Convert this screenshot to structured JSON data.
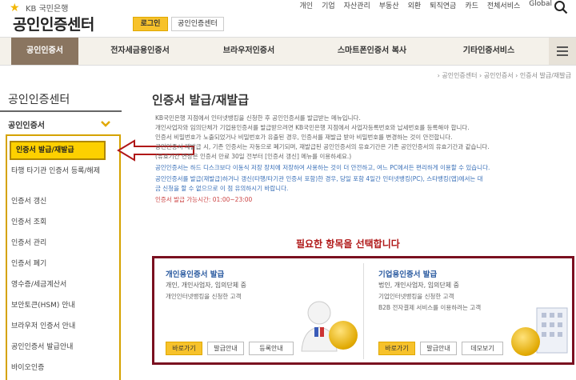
{
  "header": {
    "bank_logo_text": "KB 국민은행",
    "site_title": "공인인증센터",
    "login_label": "로그인",
    "cert_center_label": "공인인증센터",
    "gnb": [
      "개인",
      "기업",
      "자산관리",
      "부동산",
      "외환",
      "퇴직연금",
      "카드",
      "전체서비스",
      "Global"
    ]
  },
  "nav": {
    "items": [
      "공인인증서",
      "전자세금용인증서",
      "브라우저인증서",
      "스마트폰인증서 복사",
      "기타인증서비스"
    ]
  },
  "breadcrumb": "› 공인인증센터 › 공인인증서 › 인증서 발급/재발급",
  "sidebar": {
    "title": "공인인증센터",
    "group": "공인인증서",
    "items": [
      "인증서 발급/재발급",
      "타행 타기관 인증서 등록/해제",
      "인증서 갱신",
      "인증서 조회",
      "인증서 관리",
      "인증서 폐기",
      "영수증/세금계산서",
      "보안토큰(HSM) 안내",
      "브라우저 인증서 안내",
      "공인인증서 발급안내",
      "바이오인증"
    ]
  },
  "content": {
    "title": "인증서 발급/재발급",
    "bullets": [
      "KB국민은행 지점에서 인터넷뱅킹을 신청한 후 공인인증서를 발급받는 메뉴입니다.",
      "개인사업자와 임의단체가 기업용인증서를 발급받으려면 KB국민은행 지점에서 사업자등록번호와 납세번호를 등록해야 합니다.",
      "인증서 비밀번호가 노출되었거나 비밀번호가 유출된 경우, 인증서를 재발급 받아 비밀번호를 변경하는 것이 안전합니다.",
      "공인인증서 재발급 시, 기존 인증서는 자동으로 폐기되며, 재발급된 공인인증서의 유효기간은 기존 공인인증서의 유효기간과 같습니다.",
      "(유효기간 연장은 인증서 만료 30일 전부터 [인증서 갱신] 메뉴를 이용하세요.)",
      "공인인증서는 하드 디스크보다 이동식 저장 장치에 저장하여 사용하는 것이 더 안전하고, 여느 PC에서든 편리하게 이용할 수 있습니다.",
      "공인인증서를 발급(재발급)하거나 갱신(타행/타기관 인증서 포함)한 경우, 당일 포함 4일간 인터넷뱅킹(PC), 스타뱅킹(앱)에서는 대",
      "금 신청을 할 수 없으므로 이 점 유의하시기 바랍니다.",
      "인증서 발급 가능시간: 01:00~23:00"
    ],
    "notice": "필요한 항목을 선택합니다"
  },
  "cards": [
    {
      "title": "개인용인증서 발급",
      "subtitle": "개인, 개인사업자, 임의단체 중",
      "bullets": [
        "개인인터넷뱅킹을 신청한 고객"
      ],
      "buttons": [
        "바로가기",
        "발급안내",
        "등록안내"
      ]
    },
    {
      "title": "기업용인증서 발급",
      "subtitle": "법인, 개인사업자, 임의단체 중",
      "bullets": [
        "기업인터넷뱅킹을 신청한 고객",
        "B2B 전자결제 서비스를 이용하려는 고객"
      ],
      "buttons": [
        "바로가기",
        "발급안내",
        "데모보기"
      ]
    }
  ],
  "colors": {
    "accent_yellow": "#f7c22b",
    "nav_active": "#8a7560",
    "highlight_border": "#7a1020",
    "notice_red": "#b01818"
  }
}
